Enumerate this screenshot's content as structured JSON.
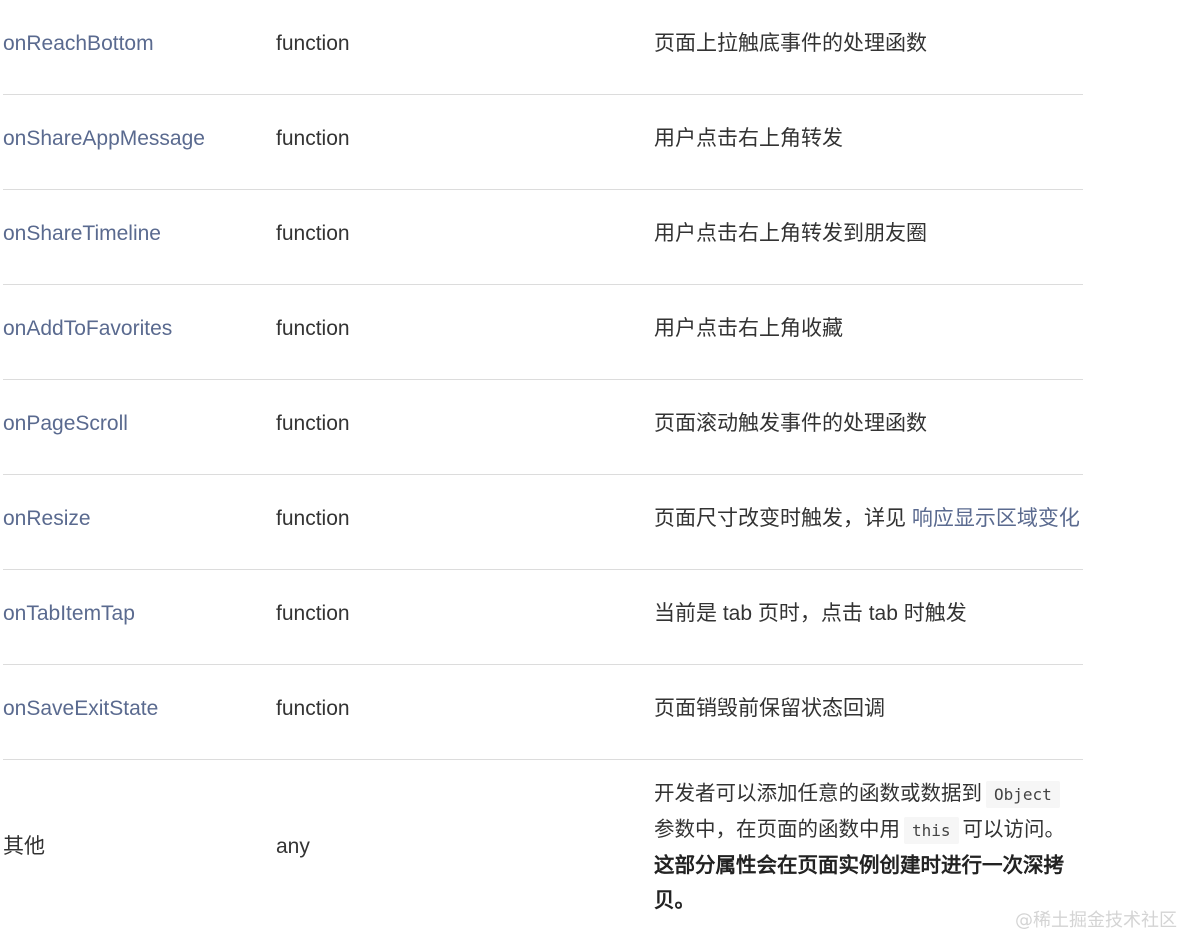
{
  "rows": [
    {
      "name": "onReachBottom",
      "type": "function",
      "desc": "页面上拉触底事件的处理函数"
    },
    {
      "name": "onShareAppMessage",
      "type": "function",
      "desc": "用户点击右上角转发"
    },
    {
      "name": "onShareTimeline",
      "type": "function",
      "desc": "用户点击右上角转发到朋友圈"
    },
    {
      "name": "onAddToFavorites",
      "type": "function",
      "desc": "用户点击右上角收藏"
    },
    {
      "name": "onPageScroll",
      "type": "function",
      "desc": "页面滚动触发事件的处理函数"
    },
    {
      "name": "onResize",
      "type": "function",
      "desc": "页面尺寸改变时触发，详见 ",
      "link": "响应显示区域变化"
    },
    {
      "name": "onTabItemTap",
      "type": "function",
      "desc": "当前是 tab 页时，点击 tab 时触发"
    },
    {
      "name": "onSaveExitState",
      "type": "function",
      "desc": "页面销毁前保留状态回调"
    }
  ],
  "other": {
    "name": "其他",
    "type": "any",
    "desc_part1": "开发者可以添加任意的函数或数据到",
    "code1": "Object",
    "desc_part2": "参数中，在页面的函数中用",
    "code2": "this",
    "desc_part3": "可以访问。",
    "bold_text": "这部分属性会在页面实例创建时进行一次深拷贝。"
  },
  "watermark": "@稀土掘金技术社区",
  "colors": {
    "link": "#5a6a8f",
    "text": "#333333",
    "divider": "#dcdcdc"
  }
}
